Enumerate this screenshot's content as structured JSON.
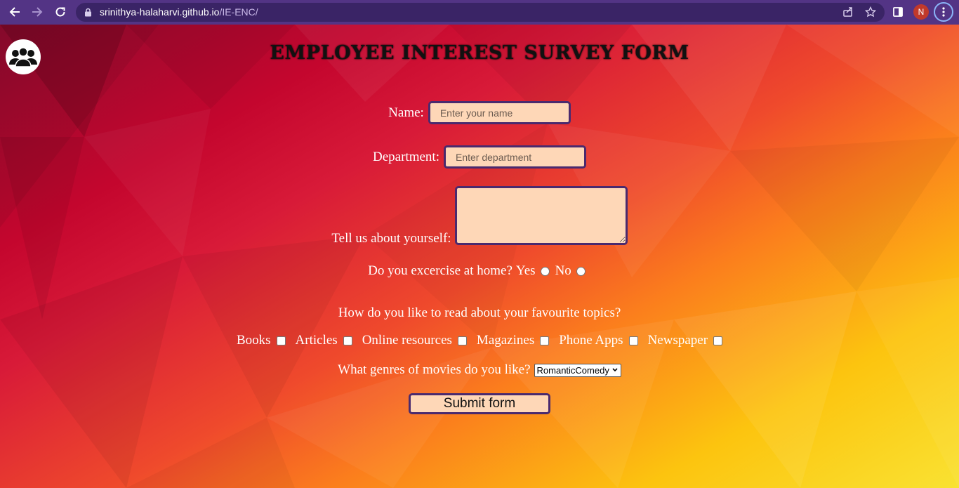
{
  "browser": {
    "url_host": "srinithya-halaharvi.github.io",
    "url_path": "/IE-ENC/",
    "profile_initial": "N"
  },
  "page": {
    "title": "EMPLOYEE INTEREST SURVEY FORM",
    "name_label": "Name:",
    "name_placeholder": "Enter your name",
    "department_label": "Department:",
    "department_placeholder": "Enter department",
    "about_label": "Tell us about yourself:",
    "exercise_question": "Do you excercise at home?",
    "exercise_yes": "Yes",
    "exercise_no": "No",
    "read_question": "How do you like to read about your favourite topics?",
    "read_options": [
      "Books",
      "Articles",
      "Online resources",
      "Magazines",
      "Phone Apps",
      "Newspaper"
    ],
    "movies_question": "What genres of movies do you like?",
    "movies_selected": "RomanticComedy",
    "submit_label": "Submit form"
  },
  "icons": {
    "back": "arrow-left-icon",
    "forward": "arrow-right-icon",
    "reload": "reload-icon",
    "lock": "lock-icon",
    "share": "share-icon",
    "bookmark": "star-icon",
    "sidepanel": "side-panel-icon",
    "menu": "more-vertical-icon",
    "logo": "people-group-icon"
  }
}
